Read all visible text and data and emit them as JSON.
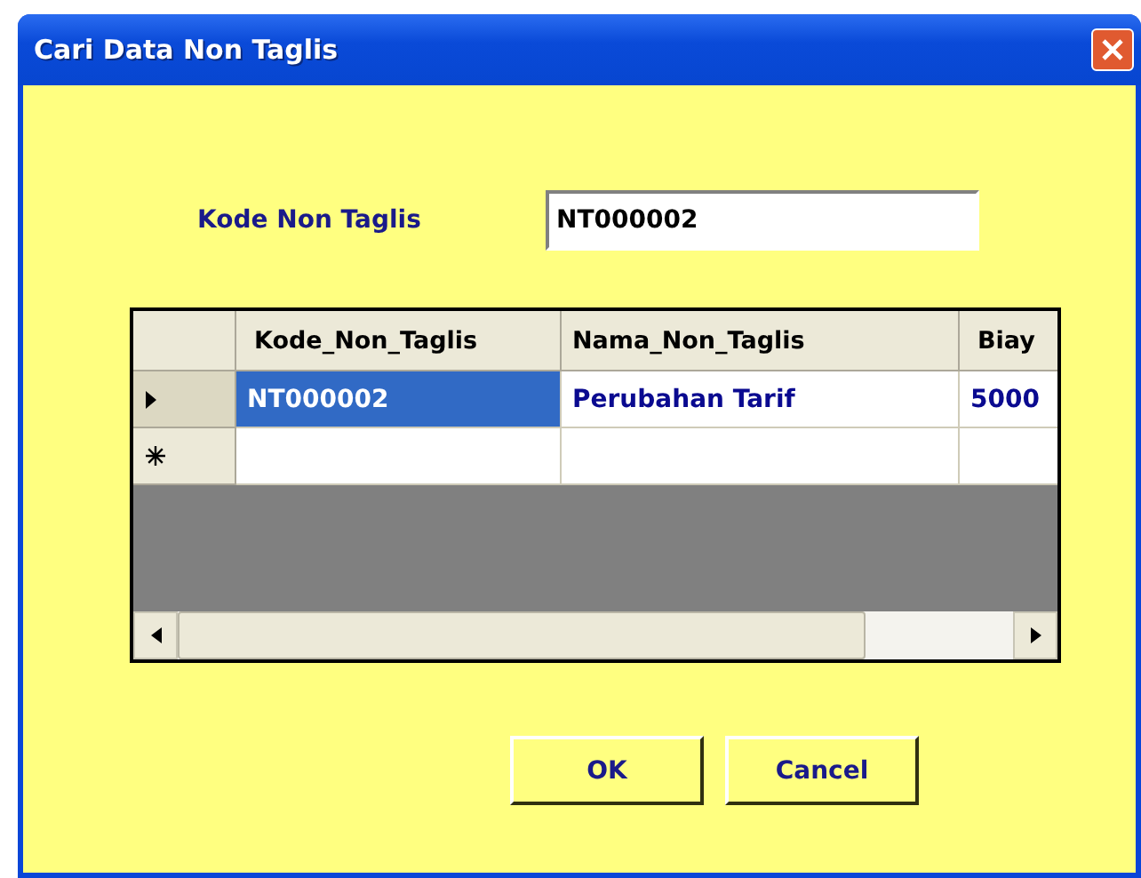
{
  "window": {
    "title": "Cari Data Non Taglis"
  },
  "search": {
    "label": "Kode Non Taglis",
    "value": "NT000002"
  },
  "table": {
    "columns": [
      "Kode_Non_Taglis",
      "Nama_Non_Taglis",
      "Biay"
    ],
    "rows": [
      {
        "kind": "current",
        "selected": true,
        "cells": [
          "NT000002",
          "Perubahan Tarif",
          "5000"
        ]
      },
      {
        "kind": "new",
        "selected": false
      }
    ]
  },
  "buttons": [
    "OK",
    "Cancel"
  ]
}
